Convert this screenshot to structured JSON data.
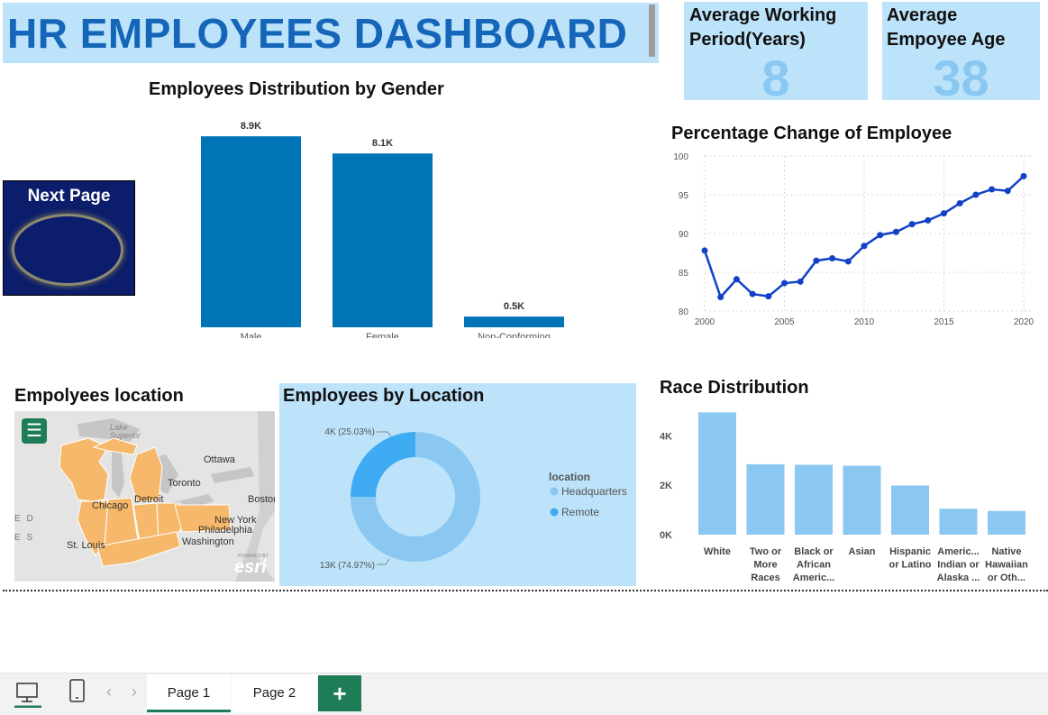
{
  "header": {
    "title": "HR EMPLOYEES DASHBOARD"
  },
  "kpis": [
    {
      "label": "Average Working Period(Years)",
      "value": "8"
    },
    {
      "label": "Average Empoyee Age",
      "value": "38"
    }
  ],
  "next_page": {
    "label": "Next Page"
  },
  "map": {
    "title": "Empolyees location",
    "labels": [
      "Lake Superior",
      "Ottawa",
      "Toronto",
      "Chicago",
      "Detroit",
      "Boston",
      "New York",
      "Philadelphia",
      "Washington",
      "St. Louis",
      "E D",
      "E S"
    ],
    "attribution": "esri",
    "powered_by": "POWERED BY"
  },
  "colors": {
    "accent": "#0173b7",
    "light_blue": "#8ac8f2",
    "panel": "#bde3fa",
    "title_blue": "#1565b8",
    "line": "#1141c6",
    "green": "#1e7d57"
  },
  "chart_data": [
    {
      "type": "bar",
      "title": "Employees Distribution by Gender",
      "categories": [
        "Male",
        "Female",
        "Non-Conforming"
      ],
      "values": [
        8900,
        8100,
        500
      ],
      "data_labels": [
        "8.9K",
        "8.1K",
        "0.5K"
      ],
      "ylim": [
        0,
        10000
      ],
      "grid": false,
      "color": "#0173b7"
    },
    {
      "type": "line",
      "title": "Percentage Change of Employee",
      "x": [
        2000,
        2001,
        2002,
        2003,
        2004,
        2005,
        2006,
        2007,
        2008,
        2009,
        2010,
        2011,
        2012,
        2013,
        2014,
        2015,
        2016,
        2017,
        2018,
        2019,
        2020
      ],
      "values": [
        87.8,
        81.8,
        84.1,
        82.2,
        81.9,
        83.6,
        83.8,
        86.5,
        86.8,
        86.4,
        88.4,
        89.8,
        90.2,
        91.2,
        91.7,
        92.6,
        93.9,
        95.0,
        95.7,
        95.5,
        97.4
      ],
      "xticks": [
        "2000",
        "2005",
        "2010",
        "2015",
        "2020"
      ],
      "yticks": [
        "80",
        "85",
        "90",
        "95",
        "100"
      ],
      "ylim": [
        80,
        100
      ],
      "grid": true,
      "color": "#1141c6"
    },
    {
      "type": "pie",
      "title": "Employees by Location",
      "legend_title": "location",
      "categories": [
        "Headquarters",
        "Remote"
      ],
      "values": [
        74.97,
        25.03
      ],
      "data_labels": [
        "13K (74.97%)",
        "4K (25.03%)"
      ],
      "colors": [
        "#8ac8f2",
        "#3fabf2"
      ],
      "legend_position": "right"
    },
    {
      "type": "bar",
      "title": "Race Distribution",
      "categories": [
        "White",
        "Two or More Races",
        "Black or African Americ...",
        "Asian",
        "Hispanic or Latino",
        "Americ... Indian or Alaska ...",
        "Native Hawaiian or Oth..."
      ],
      "category_lines": [
        [
          "White"
        ],
        [
          "Two or",
          "More",
          "Races"
        ],
        [
          "Black or",
          "African",
          "Americ..."
        ],
        [
          "Asian"
        ],
        [
          "Hispanic",
          "or Latino"
        ],
        [
          "Americ...",
          "Indian or",
          "Alaska ..."
        ],
        [
          "Native",
          "Hawaiian",
          "or Oth..."
        ]
      ],
      "values": [
        4950,
        2850,
        2830,
        2790,
        1990,
        1050,
        960
      ],
      "yticks": [
        "0K",
        "2K",
        "4K"
      ],
      "ylim": [
        0,
        5000
      ],
      "color": "#8ac8f2"
    }
  ],
  "bottom_bar": {
    "tabs": [
      "Page 1",
      "Page 2"
    ],
    "active_tab": "Page 1",
    "add_label": "+",
    "prev_arrow": "‹",
    "next_arrow": "›"
  }
}
